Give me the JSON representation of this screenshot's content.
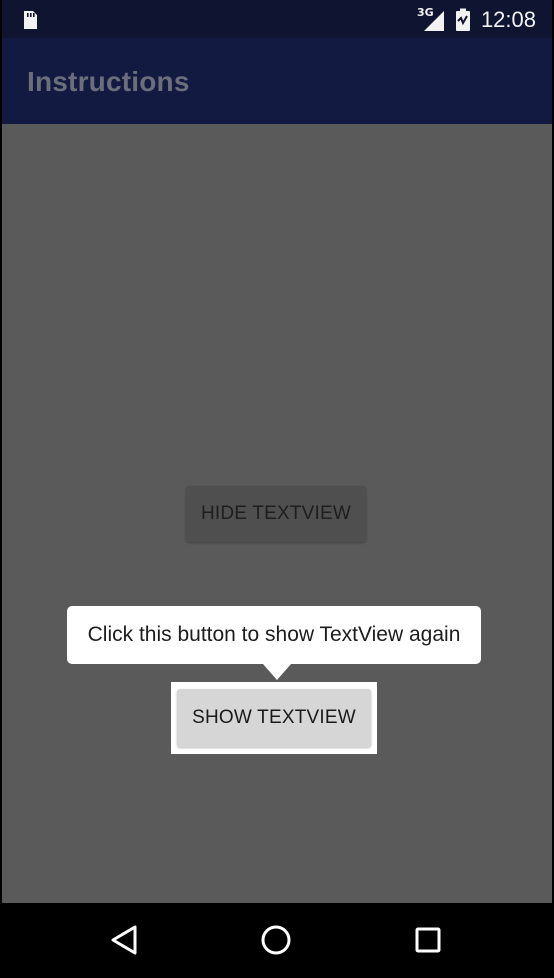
{
  "status_bar": {
    "network_type": "3G",
    "time": "12:08",
    "icons": [
      "sd-card-icon",
      "signal-icon",
      "battery-icon"
    ]
  },
  "app_bar": {
    "title": "Instructions"
  },
  "main": {
    "hide_button_label": "HIDE TEXTVIEW",
    "tooltip_text": "Click this button to show TextView again",
    "show_button_label": "SHOW TEXTVIEW"
  },
  "nav_bar": {
    "icons": [
      "back-icon",
      "home-icon",
      "recent-apps-icon"
    ]
  },
  "colors": {
    "status_bar": "#0f1430",
    "app_bar": "#131a41",
    "content_dim": "#5a5a5a",
    "tooltip_bg": "#ffffff",
    "button_bg": "#d6d6d6"
  }
}
